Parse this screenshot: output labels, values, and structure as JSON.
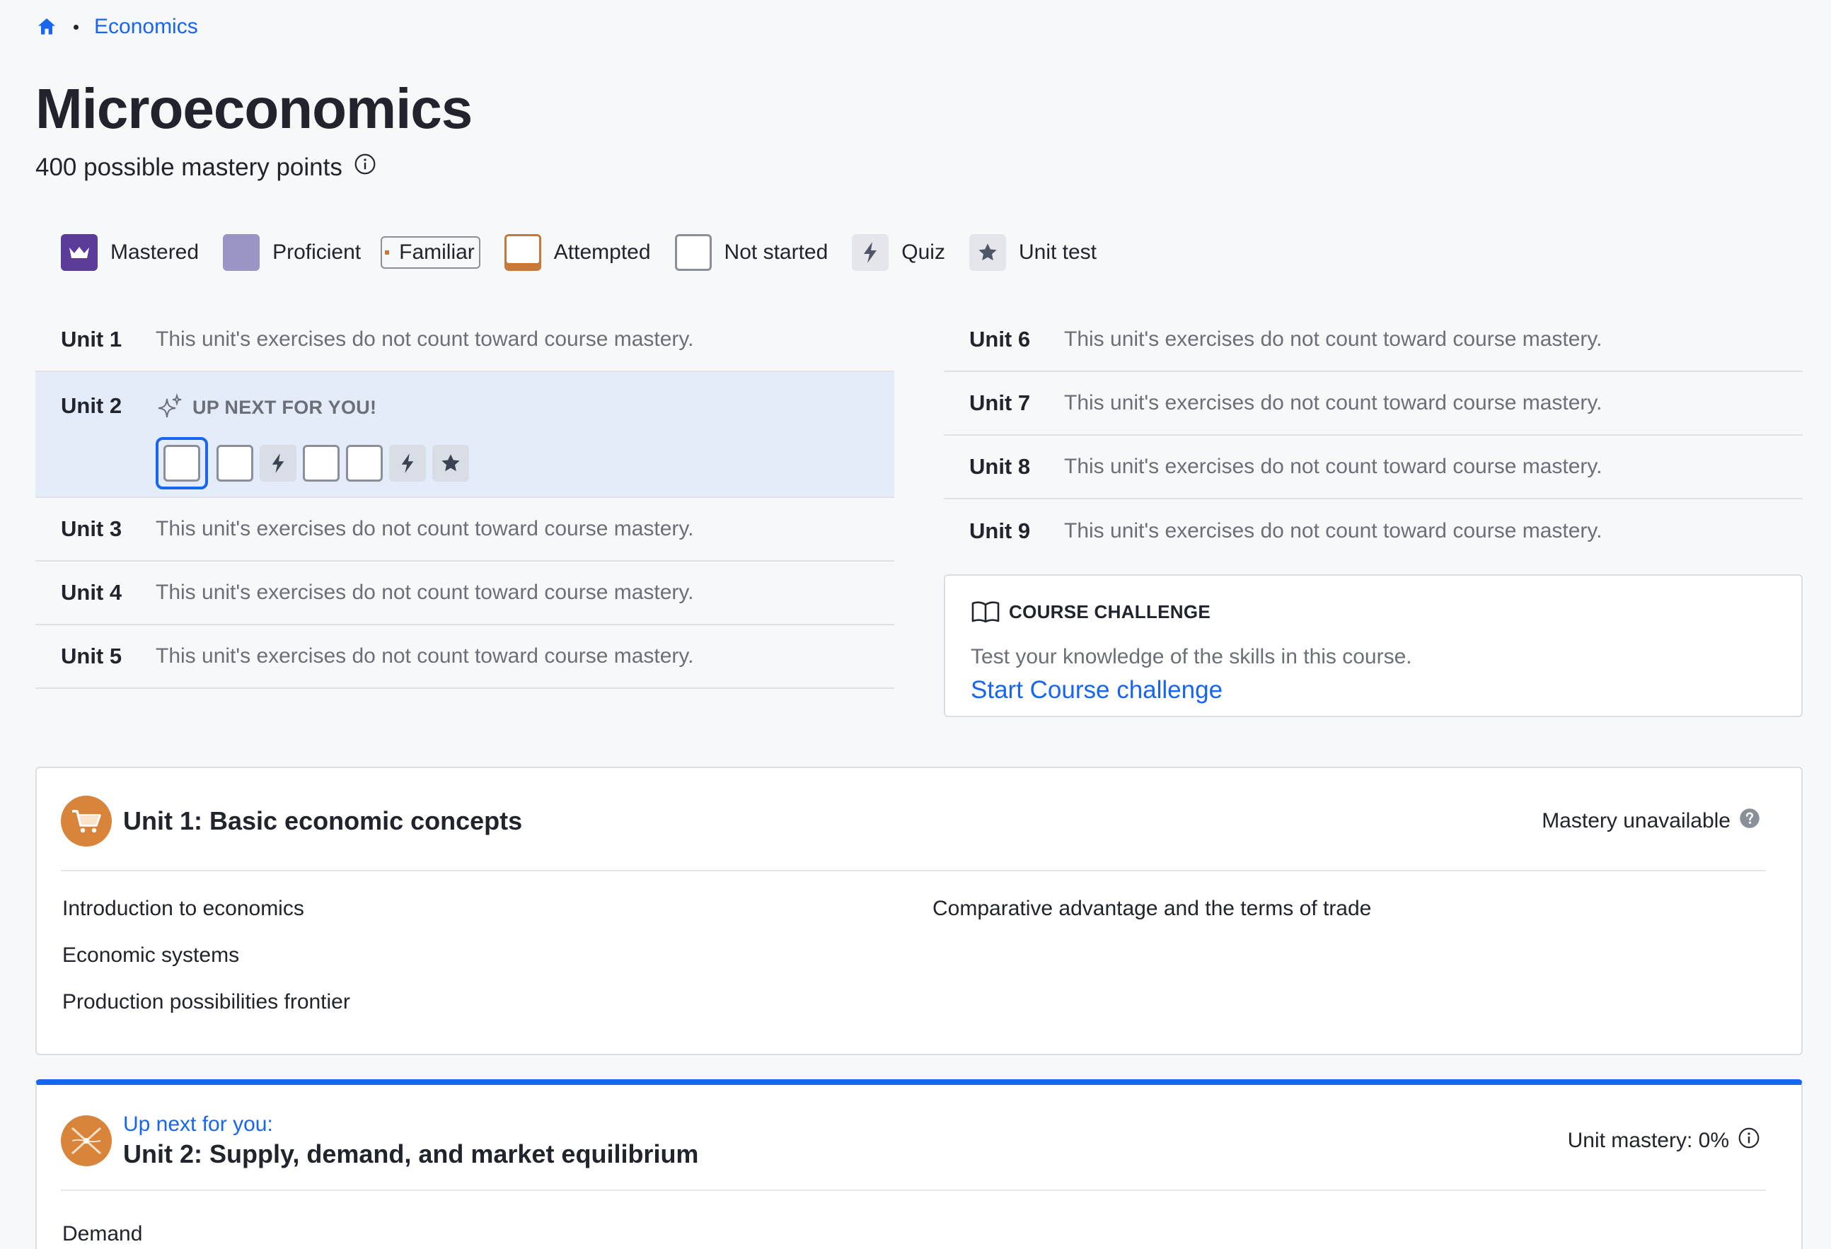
{
  "breadcrumb": {
    "link": "Economics"
  },
  "course": {
    "title": "Microeconomics",
    "mastery_points": "400 possible mastery points"
  },
  "legend": {
    "mastered": "Mastered",
    "proficient": "Proficient",
    "familiar": "Familiar",
    "attempted": "Attempted",
    "not_started": "Not started",
    "quiz": "Quiz",
    "unit_test": "Unit test"
  },
  "units_left": [
    {
      "name": "Unit 1",
      "desc": "This unit's exercises do not count toward course mastery."
    },
    {
      "name": "Unit 2",
      "up_next": "UP NEXT FOR YOU!"
    },
    {
      "name": "Unit 3",
      "desc": "This unit's exercises do not count toward course mastery."
    },
    {
      "name": "Unit 4",
      "desc": "This unit's exercises do not count toward course mastery."
    },
    {
      "name": "Unit 5",
      "desc": "This unit's exercises do not count toward course mastery."
    }
  ],
  "units_right": [
    {
      "name": "Unit 6",
      "desc": "This unit's exercises do not count toward course mastery."
    },
    {
      "name": "Unit 7",
      "desc": "This unit's exercises do not count toward course mastery."
    },
    {
      "name": "Unit 8",
      "desc": "This unit's exercises do not count toward course mastery."
    },
    {
      "name": "Unit 9",
      "desc": "This unit's exercises do not count toward course mastery."
    }
  ],
  "challenge": {
    "title": "COURSE CHALLENGE",
    "desc": "Test your knowledge of the skills in this course.",
    "link": "Start Course challenge"
  },
  "unit1_card": {
    "title": "Unit 1: Basic economic concepts",
    "status": "Mastery unavailable",
    "lessons": [
      "Introduction to economics",
      "Economic systems",
      "Production possibilities frontier",
      "Comparative advantage and the terms of trade"
    ]
  },
  "unit2_card": {
    "up_next": "Up next for you:",
    "title": "Unit 2: Supply, demand, and market equilibrium",
    "status": "Unit mastery: 0%",
    "lessons": [
      "Demand"
    ]
  },
  "colors": {
    "accent": "#1865f2",
    "mastered": "#5b3d99",
    "proficient": "#9b94c7",
    "familiar": "#d8843a",
    "unit_icon": "#d8843a",
    "active_row": "#e3ecf8"
  },
  "icons": {
    "home": "home-icon",
    "info": "info-icon",
    "quiz": "lightning-icon",
    "unit_test": "star-icon",
    "up_next": "sparkle-icon",
    "challenge": "book-icon",
    "help": "question-icon",
    "unit1": "shopping-cart-icon",
    "unit2": "supply-demand-icon"
  }
}
